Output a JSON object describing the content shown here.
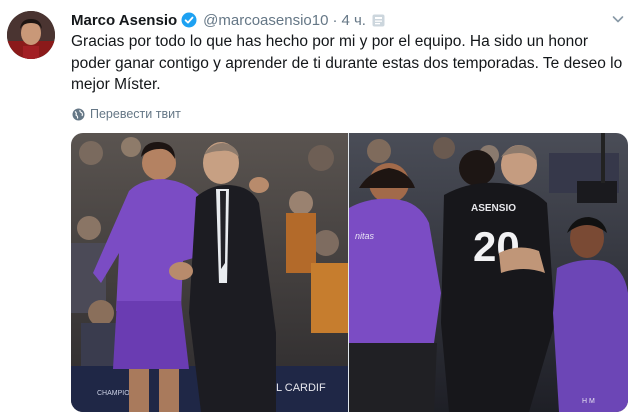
{
  "author": {
    "name": "Marco Asensio",
    "handle": "@marcoasensio10",
    "separator": "·",
    "time": "4 ч."
  },
  "tweet": {
    "text": "Gracias por todo lo que has hecho por mi y por el equipo. Ha sido un honor poder ganar contigo y aprender de ti durante estas dos temporadas. Te deseo lo mejor Míster."
  },
  "translate_label": "Перевести твит",
  "media": {
    "left_photo": {
      "banner_left": "CHAMPIONS",
      "banner_right": "L CARDIF"
    },
    "right_photo": {
      "jersey_name": "ASENSIO",
      "jersey_number": "20",
      "sponsor": "nitas",
      "initials": "H M"
    }
  },
  "colors": {
    "verified": "#1da1f2",
    "purple_kit": "#7b4cc4",
    "link_gray": "#657786"
  },
  "icons": {
    "verified": "verified-badge-icon",
    "feed": "feed-icon",
    "chevron": "chevron-down-icon",
    "globe": "globe-icon"
  }
}
